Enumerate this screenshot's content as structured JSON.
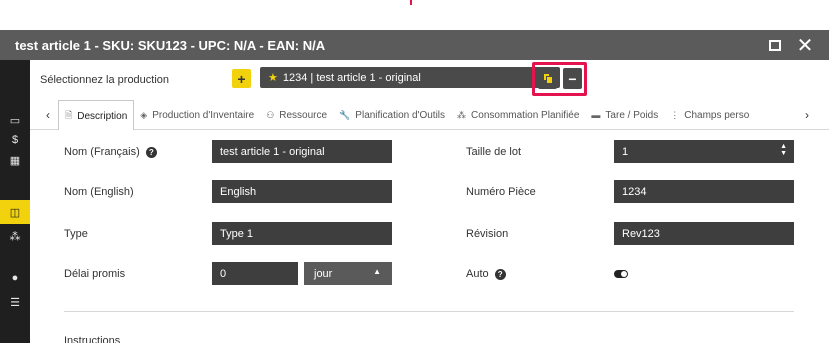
{
  "window": {
    "title": "test article 1 - SKU: SKU123 - UPC: N/A - EAN: N/A",
    "maximize_icon": "maximize-icon",
    "close_icon": "close-icon"
  },
  "rail": {
    "items": [
      {
        "icon": "document-icon",
        "glyph": "🗎"
      },
      {
        "icon": "card-icon",
        "glyph": "▭"
      },
      {
        "icon": "dollar-icon",
        "glyph": "$"
      },
      {
        "icon": "calculator-icon",
        "glyph": "▦"
      },
      {
        "icon": "copy-icon",
        "glyph": "◫"
      },
      {
        "icon": "cubes-icon",
        "glyph": "⁂"
      },
      {
        "icon": "comment-icon",
        "glyph": "●"
      },
      {
        "icon": "list-icon",
        "glyph": "☰"
      }
    ]
  },
  "production": {
    "label": "Sélectionnez la production",
    "add_label": "+",
    "selected": "1234 | test article 1 - original",
    "minus_label": "−"
  },
  "tabs": [
    {
      "label": "Description",
      "icon": "document-icon",
      "glyph": "🗎",
      "active": true
    },
    {
      "label": "Production d'Inventaire",
      "icon": "cube-icon",
      "glyph": "◈",
      "active": false
    },
    {
      "label": "Ressource",
      "icon": "users-icon",
      "glyph": "⚇",
      "active": false
    },
    {
      "label": "Planification d'Outils",
      "icon": "wrench-icon",
      "glyph": "🔧",
      "active": false
    },
    {
      "label": "Consommation Planifiée",
      "icon": "cubes-icon",
      "glyph": "⁂",
      "active": false
    },
    {
      "label": "Tare / Poids",
      "icon": "scale-icon",
      "glyph": "▬",
      "active": false
    },
    {
      "label": "Champs perso",
      "icon": "ellipsis-icon",
      "glyph": "⋮",
      "active": false
    }
  ],
  "form": {
    "name_fr_label": "Nom (Français)",
    "name_fr_value": "test article 1 - original",
    "name_en_label": "Nom (English)",
    "name_en_value": "English",
    "type_label": "Type",
    "type_value": "Type 1",
    "lead_label": "Délai promis",
    "lead_value": "0",
    "lead_unit": "jour",
    "lot_label": "Taille de lot",
    "lot_value": "1",
    "part_label": "Numéro Pièce",
    "part_value": "1234",
    "revision_label": "Révision",
    "revision_value": "Rev123",
    "auto_label": "Auto",
    "auto_on": true,
    "instructions_label": "Instructions"
  }
}
